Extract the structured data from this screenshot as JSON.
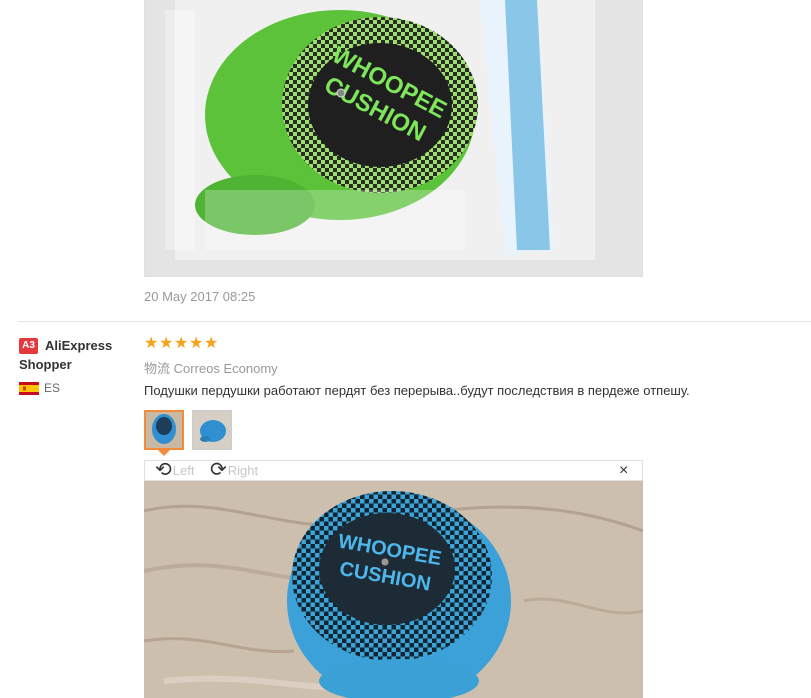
{
  "review1": {
    "date": "20 May 2017 08:25"
  },
  "review2": {
    "badge": "A3",
    "user": "AliExpress Shopper",
    "country": "ES",
    "stars": [
      "★",
      "★",
      "★",
      "★",
      "★"
    ],
    "rating": 5,
    "shipping_prefix": "物流",
    "shipping": "Correos Economy",
    "text": "Подушки пердушки работают пердят без перерыва..будут последствия в пердеже отпешу.",
    "rotate_left": "Left",
    "rotate_right": "Right",
    "close": "×"
  },
  "photos": {
    "cushion_text_line1": "WHOOPEE",
    "cushion_text_line2": "CUSHION"
  },
  "colors": {
    "star": "#f7a21b",
    "badge": "#e4393c",
    "thumb_selected": "#f08c3c"
  }
}
